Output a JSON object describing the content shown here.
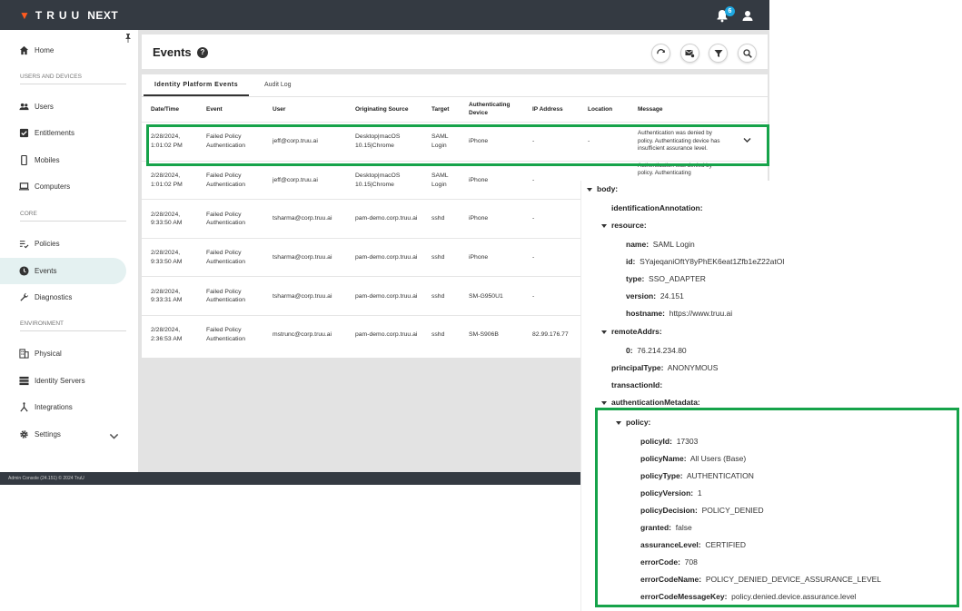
{
  "app": {
    "brand": "TRUU",
    "product": "NEXT",
    "notification_count": "6",
    "footer": "Admin Console (24.151) © 2024 TruU"
  },
  "sidebar": {
    "items": [
      {
        "label": "Home",
        "icon": "home-icon"
      },
      {
        "label": "Users",
        "icon": "users-icon"
      },
      {
        "label": "Entitlements",
        "icon": "checkbox-icon"
      },
      {
        "label": "Mobiles",
        "icon": "phone-icon"
      },
      {
        "label": "Computers",
        "icon": "laptop-icon"
      },
      {
        "label": "Policies",
        "icon": "policy-list-icon"
      },
      {
        "label": "Events",
        "icon": "clock-icon"
      },
      {
        "label": "Diagnostics",
        "icon": "wrench-icon"
      },
      {
        "label": "Physical",
        "icon": "building-icon"
      },
      {
        "label": "Identity Servers",
        "icon": "server-icon"
      },
      {
        "label": "Integrations",
        "icon": "integration-icon"
      },
      {
        "label": "Settings",
        "icon": "gear-icon"
      }
    ],
    "sections": [
      "USERS AND DEVICES",
      "CORE",
      "ENVIRONMENT"
    ],
    "active": "Events"
  },
  "page": {
    "title": "Events"
  },
  "tabs": [
    "Identity Platform Events",
    "Audit Log"
  ],
  "table": {
    "columns": [
      "Date/Time",
      "Event",
      "User",
      "Originating Source",
      "Target",
      "Authenticating Device",
      "IP Address",
      "Location",
      "Message"
    ],
    "rows": [
      {
        "date": "2/28/2024, 1:01:02 PM",
        "event": "Failed Policy Authentication",
        "user": "jeff@corp.truu.ai",
        "source": "Desktop|macOS 10.15|Chrome",
        "target": "SAML Login",
        "device": "iPhone",
        "ip": "-",
        "location": "-",
        "message": "Authentication was denied by policy. Authenticating device has insufficient assurance level."
      },
      {
        "date": "2/28/2024, 1:01:02 PM",
        "event": "Failed Policy Authentication",
        "user": "jeff@corp.truu.ai",
        "source": "Desktop|macOS 10.15|Chrome",
        "target": "SAML Login",
        "device": "iPhone",
        "ip": "-",
        "location": "",
        "message": "Authentication was denied by policy. Authenticating"
      },
      {
        "date": "2/28/2024, 9:33:50 AM",
        "event": "Failed Policy Authentication",
        "user": "tsharma@corp.truu.ai",
        "source": "pam-demo.corp.truu.ai",
        "target": "sshd",
        "device": "iPhone",
        "ip": "-",
        "location": "",
        "message": ""
      },
      {
        "date": "2/28/2024, 9:33:50 AM",
        "event": "Failed Policy Authentication",
        "user": "tsharma@corp.truu.ai",
        "source": "pam-demo.corp.truu.ai",
        "target": "sshd",
        "device": "iPhone",
        "ip": "-",
        "location": "",
        "message": ""
      },
      {
        "date": "2/28/2024, 9:33:31 AM",
        "event": "Failed Policy Authentication",
        "user": "tsharma@corp.truu.ai",
        "source": "pam-demo.corp.truu.ai",
        "target": "sshd",
        "device": "SM-G950U1",
        "ip": "-",
        "location": "",
        "message": ""
      },
      {
        "date": "2/28/2024, 2:36:53 AM",
        "event": "Failed Policy Authentication",
        "user": "mstrunc@corp.truu.ai",
        "source": "pam-demo.corp.truu.ai",
        "target": "sshd",
        "device": "SM-S906B",
        "ip": "82.99.176.77",
        "location": "",
        "message": ""
      }
    ]
  },
  "detail": {
    "body_key": "body:",
    "identificationAnnotation_key": "identificationAnnotation:",
    "resource_key": "resource:",
    "resource": [
      {
        "key": "name:",
        "value": "SAML Login"
      },
      {
        "key": "id:",
        "value": "SYajeqaniOftY8yPhEK6eat1Zfb1eZ22atOl"
      },
      {
        "key": "type:",
        "value": "SSO_ADAPTER"
      },
      {
        "key": "version:",
        "value": "24.151"
      },
      {
        "key": "hostname:",
        "value": "https://www.truu.ai"
      }
    ],
    "remoteAddrs_key": "remoteAddrs:",
    "remoteAddr0_key": "0:",
    "remoteAddr0": "76.214.234.80",
    "principalType_key": "principalType:",
    "principalType": "ANONYMOUS",
    "transactionId_key": "transactionId:",
    "authenticationMetadata_key": "authenticationMetadata:",
    "policy_key": "policy:",
    "policy": [
      {
        "key": "policyId:",
        "value": "17303"
      },
      {
        "key": "policyName:",
        "value": "All Users (Base)"
      },
      {
        "key": "policyType:",
        "value": "AUTHENTICATION"
      },
      {
        "key": "policyVersion:",
        "value": "1"
      },
      {
        "key": "policyDecision:",
        "value": "POLICY_DENIED"
      },
      {
        "key": "granted:",
        "value": "false"
      },
      {
        "key": "assuranceLevel:",
        "value": "CERTIFIED"
      },
      {
        "key": "errorCode:",
        "value": "708"
      },
      {
        "key": "errorCodeName:",
        "value": "POLICY_DENIED_DEVICE_ASSURANCE_LEVEL"
      },
      {
        "key": "errorCodeMessageKey:",
        "value": "policy.denied.device.assurance.level"
      }
    ]
  },
  "colors": {
    "topbar": "#343a42",
    "accent": "#ff5a1f",
    "highlight": "#16a34a",
    "active_nav": "#e4f1f1",
    "badge": "#1ea7e1"
  }
}
